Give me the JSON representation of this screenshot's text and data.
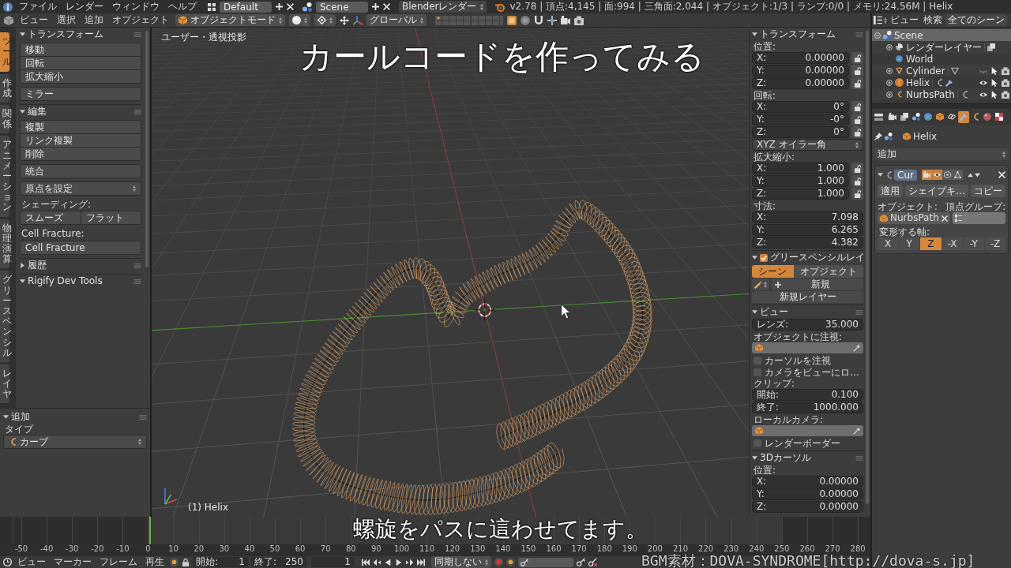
{
  "info_header": {
    "menus": [
      "ファイル",
      "レンダー",
      "ウィンドウ",
      "ヘルプ"
    ],
    "layout": "Default",
    "scene": "Scene",
    "engine": "Blenderレンダー",
    "stats": "v2.78 | 頂点:4,145 | 面:994 | 三角面:2,044 | オブジェクト:1/3 | ランプ:0/0 | メモリ:24.56M | Helix"
  },
  "view3d_header": {
    "menus": [
      "ビュー",
      "選択",
      "追加",
      "オブジェクト"
    ],
    "mode": "オブジェクトモード",
    "orientation": "グローバル"
  },
  "outliner_header": {
    "menus": [
      "ビュー",
      "検索"
    ],
    "display": "全てのシーン"
  },
  "tool_shelf": {
    "tabs": [
      {
        "label": "ツール",
        "selected": true
      },
      {
        "label": "作成",
        "selected": false
      },
      {
        "label": "関係",
        "selected": false
      },
      {
        "label": "アニメーション",
        "selected": false
      },
      {
        "label": "物理演算",
        "selected": false
      },
      {
        "label": "グリースペンシル",
        "selected": false
      },
      {
        "label": "レイヤ",
        "selected": false
      }
    ],
    "panels": [
      {
        "title": "トランスフォーム",
        "expanded": true,
        "items": [
          {
            "kind": "stack",
            "labels": [
              "移動",
              "回転",
              "拡大縮小"
            ]
          },
          {
            "kind": "stack",
            "labels": [
              "ミラー"
            ]
          }
        ]
      },
      {
        "title": "編集",
        "expanded": true,
        "items": [
          {
            "kind": "stack",
            "labels": [
              "複製",
              "リンク複製",
              "削除"
            ]
          },
          {
            "kind": "stack",
            "labels": [
              "統合"
            ]
          },
          {
            "kind": "dropdown",
            "labels": [
              "原点を設定"
            ]
          },
          {
            "kind": "label",
            "labels": [
              "シェーディング:"
            ]
          },
          {
            "kind": "row",
            "labels": [
              "スムーズ",
              "フラット"
            ]
          },
          {
            "kind": "label",
            "labels": [
              "Cell Fracture:"
            ]
          },
          {
            "kind": "stack",
            "labels": [
              "Cell Fracture"
            ]
          }
        ]
      },
      {
        "title": "履歴",
        "expanded": false
      },
      {
        "title": "Rigify Dev Tools",
        "expanded": true
      }
    ],
    "operator": {
      "title": "追加",
      "expanded": true,
      "type_label": "タイプ",
      "type_value": "カーブ"
    }
  },
  "viewport": {
    "view_name": "ユーザー・透視投影",
    "object_info": "(1) Helix",
    "caption": "カールコードを作ってみる"
  },
  "sidebar": {
    "transform": {
      "title": "トランスフォーム",
      "expanded": true,
      "groups": [
        {
          "kind": "vector",
          "label": "位置:",
          "fields": [
            {
              "axis": "X:",
              "value": "0.00000",
              "locked": false
            },
            {
              "axis": "Y:",
              "value": "0.00000",
              "locked": false
            },
            {
              "axis": "Z:",
              "value": "0.00000",
              "locked": false
            }
          ]
        },
        {
          "kind": "vector",
          "label": "回転:",
          "fields": [
            {
              "axis": "X:",
              "value": "0°",
              "locked": false
            },
            {
              "axis": "Y:",
              "value": "-0°",
              "locked": false
            },
            {
              "axis": "Z:",
              "value": "0°",
              "locked": false
            }
          ]
        },
        {
          "kind": "dropdown",
          "value": "XYZ オイラー角"
        },
        {
          "kind": "vector",
          "label": "拡大縮小:",
          "fields": [
            {
              "axis": "X:",
              "value": "1.000",
              "locked": false
            },
            {
              "axis": "Y:",
              "value": "1.000",
              "locked": false
            },
            {
              "axis": "Z:",
              "value": "1.000",
              "locked": false
            }
          ]
        },
        {
          "kind": "vector",
          "label": "寸法:",
          "fields": [
            {
              "axis": "X:",
              "value": "7.098"
            },
            {
              "axis": "Y:",
              "value": "6.265"
            },
            {
              "axis": "Z:",
              "value": "4.382"
            }
          ]
        }
      ]
    },
    "grease_pencil": {
      "title": "グリースペンシルレイ",
      "expanded": true,
      "enabled": true,
      "sources": [
        {
          "label": "シーン",
          "selected": true
        },
        {
          "label": "オブジェクト",
          "selected": false
        }
      ],
      "new": "新規",
      "new_layer": "新規レイヤー"
    },
    "view": {
      "title": "ビュー",
      "expanded": true,
      "lens_label": "レンズ:",
      "lens": "35.000",
      "lock_label": "オブジェクトに注視:",
      "options": [
        {
          "label": "カーソルを注視",
          "checked": false
        },
        {
          "label": "カメラをビューにロ…",
          "checked": false
        }
      ],
      "clip_label": "クリップ:",
      "clip": [
        {
          "label": "開始:",
          "value": "0.100"
        },
        {
          "label": "終了:",
          "value": "1000.000"
        }
      ],
      "camera_label": "ローカルカメラ:",
      "border": {
        "label": "レンダーボーダー",
        "checked": false
      }
    },
    "cursor": {
      "title": "3Dカーソル",
      "expanded": true,
      "label": "位置:",
      "fields": [
        {
          "axis": "X:",
          "value": "0.00000"
        },
        {
          "axis": "Y:",
          "value": "0.00000"
        },
        {
          "axis": "Z:",
          "value": "0.00000"
        }
      ]
    }
  },
  "outliner": {
    "tree": [
      {
        "name": "Scene",
        "kind": "scene",
        "selected": true,
        "expanded": true,
        "children": [
          {
            "name": "レンダーレイヤー",
            "kind": "render_layers",
            "selected": false,
            "expanded": false
          },
          {
            "name": "World",
            "kind": "world",
            "selected": false
          },
          {
            "name": "Cylinder",
            "kind": "mesh",
            "selected": false,
            "expanded": false,
            "visible": false,
            "active": false,
            "modifier": false
          },
          {
            "name": "Helix",
            "kind": "curve",
            "selected": false,
            "expanded": false,
            "visible": true,
            "active": true,
            "modifier": true
          },
          {
            "name": "NurbsPath",
            "kind": "curve",
            "selected": false,
            "expanded": false,
            "visible": true,
            "active": false,
            "modifier": false
          }
        ]
      }
    ]
  },
  "properties": {
    "tabs": [
      {
        "kind": "render",
        "selected": false
      },
      {
        "kind": "render_layers",
        "selected": false
      },
      {
        "kind": "scene",
        "selected": false
      },
      {
        "kind": "world",
        "selected": false
      },
      {
        "kind": "object",
        "selected": false
      },
      {
        "kind": "constraints",
        "selected": false
      },
      {
        "kind": "modifiers",
        "selected": true
      },
      {
        "kind": "data",
        "selected": false
      },
      {
        "kind": "material",
        "selected": false
      },
      {
        "kind": "texture",
        "selected": false
      }
    ],
    "context": "Helix",
    "add_modifier": "追加",
    "modifier": {
      "name": "Cur",
      "expanded": true,
      "toggles": [
        {
          "kind": "render",
          "on": true
        },
        {
          "kind": "viewport",
          "on": true
        },
        {
          "kind": "editmode",
          "on": false
        },
        {
          "kind": "cage",
          "on": false
        }
      ],
      "actions": [
        "適用",
        "シェイプキ…",
        "コピー"
      ],
      "object_label": "オブジェクト:",
      "object": "NurbsPath",
      "vgroup_label": "頂点グループ:",
      "axis_label": "変形する軸:",
      "axes": [
        {
          "label": "X",
          "selected": false
        },
        {
          "label": "Y",
          "selected": false
        },
        {
          "label": "Z",
          "selected": true
        },
        {
          "label": "-X",
          "selected": false
        },
        {
          "label": "-Y",
          "selected": false
        },
        {
          "label": "-Z",
          "selected": false
        }
      ]
    }
  },
  "timeline": {
    "ruler": [
      "-50",
      "-40",
      "-30",
      "-20",
      "-10",
      "0",
      "10",
      "20",
      "30",
      "40",
      "50",
      "60",
      "70",
      "80",
      "90",
      "100",
      "110",
      "120",
      "130",
      "140",
      "150",
      "160",
      "170",
      "180",
      "190",
      "200",
      "210",
      "220",
      "230",
      "240",
      "250",
      "260",
      "270",
      "280"
    ]
  },
  "timeline_header": {
    "menus": [
      "ビュー",
      "マーカー",
      "フレーム",
      "再生"
    ],
    "start_label": "開始:",
    "start": "1",
    "end_label": "終了:",
    "end": "250",
    "current": "1",
    "sync": "同期しない"
  },
  "captions": {
    "subtitle": "螺旋をパスに這わせてます。",
    "credit": "BGM素材：DOVA-SYNDROME[http://dova-s.jp]"
  }
}
